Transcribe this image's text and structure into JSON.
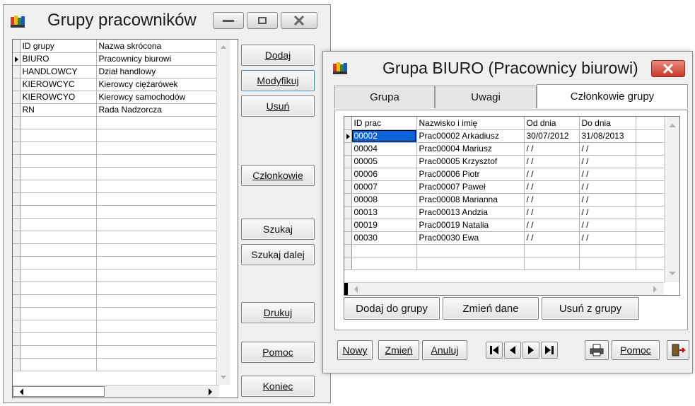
{
  "groups_window": {
    "title": "Grupy pracowników",
    "columns": [
      "ID grupy",
      "Nazwa skrócona"
    ],
    "rows": [
      {
        "id": "BIURO",
        "name": "Pracownicy biurowi"
      },
      {
        "id": "HANDLOWCY",
        "name": "Dział handlowy"
      },
      {
        "id": "KIEROWCYC",
        "name": "Kierowcy ciężarówek"
      },
      {
        "id": "KIEROWCYO",
        "name": "Kierowcy samochodów"
      },
      {
        "id": "RN",
        "name": "Rada Nadzorcza"
      }
    ],
    "buttons": {
      "dodaj": "Dodaj",
      "modyfikuj": "Modyfikuj",
      "usun": "Usuń",
      "czlonkowie": "Członkowie",
      "szukaj": "Szukaj",
      "szukaj_dalej": "Szukaj dalej",
      "drukuj": "Drukuj",
      "pomoc": "Pomoc",
      "koniec": "Koniec"
    }
  },
  "group_window": {
    "title": "Grupa BIURO (Pracownicy biurowi)",
    "tabs": [
      "Grupa",
      "Uwagi",
      "Członkowie grupy"
    ],
    "active_tab": "Członkowie grupy",
    "columns": [
      "ID prac",
      "Nazwisko i imię",
      "Od dnia",
      "Do dnia"
    ],
    "rows": [
      {
        "id": "00002",
        "name": "Prac00002 Arkadiusz",
        "from": "30/07/2012",
        "to": "31/08/2013"
      },
      {
        "id": "00004",
        "name": "Prac00004 Mariusz",
        "from": "/ /",
        "to": "/ /"
      },
      {
        "id": "00005",
        "name": "Prac00005 Krzysztof",
        "from": "/ /",
        "to": "/ /"
      },
      {
        "id": "00006",
        "name": "Prac00006 Piotr",
        "from": "/ /",
        "to": "/ /"
      },
      {
        "id": "00007",
        "name": "Prac00007 Paweł",
        "from": "/ /",
        "to": "/ /"
      },
      {
        "id": "00008",
        "name": "Prac00008 Marianna",
        "from": "/ /",
        "to": "/ /"
      },
      {
        "id": "00013",
        "name": "Prac00013 Andzia",
        "from": "/ /",
        "to": "/ /"
      },
      {
        "id": "00019",
        "name": "Prac00019 Natalia",
        "from": "/ /",
        "to": "/ /"
      },
      {
        "id": "00030",
        "name": "Prac00030 Ewa",
        "from": "/ /",
        "to": "/ /"
      }
    ],
    "member_buttons": {
      "add": "Dodaj do grupy",
      "change": "Zmień dane",
      "remove": "Usuń z grupy"
    },
    "bottom_buttons": {
      "new": "Nowy",
      "change": "Zmień",
      "cancel": "Anuluj",
      "help": "Pomoc"
    }
  },
  "colors": {
    "close_button": "#d9463a",
    "selection": "#0a64d8"
  }
}
